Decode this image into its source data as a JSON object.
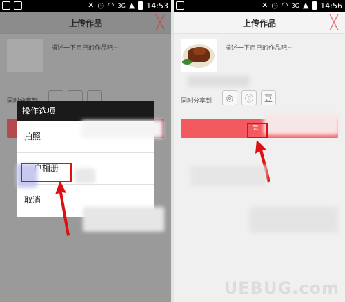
{
  "left": {
    "status_time": "14:53",
    "net": "3G",
    "title": "上传作品",
    "close": "╳",
    "desc_placeholder": "描述一下自己的作品吧~",
    "share_label": "同时分享到:",
    "dialog": {
      "title": "操作选项",
      "options": [
        "拍照",
        "户相册",
        "取消"
      ]
    }
  },
  "right": {
    "status_time": "14:56",
    "net": "3G",
    "title": "上传作品",
    "close": "╳",
    "desc_placeholder": "描述一下自己的作品吧~",
    "share_label": "同时分享到:",
    "share_icons": [
      "weibo-icon",
      "pinterest-icon",
      "douban-icon"
    ],
    "share_glyphs": [
      "◎",
      "ⓟ",
      "豆"
    ],
    "done_label": "完"
  },
  "watermark": "UEBUG.com",
  "colors": {
    "accent": "#f25a60",
    "highlight": "#d11111",
    "arrow": "#d11111"
  }
}
